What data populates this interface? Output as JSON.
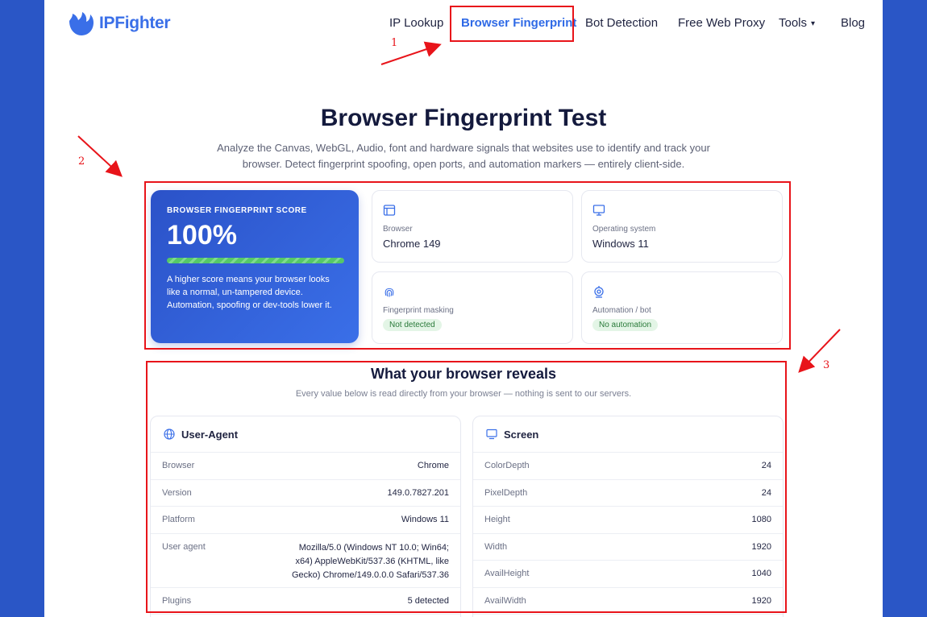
{
  "nav": {
    "brand": "IPFighter",
    "items": [
      "IP Lookup",
      "Browser Fingerprint",
      "Bot Detection",
      "Free Web Proxy",
      "Tools",
      "Blog"
    ],
    "active": "Browser Fingerprint"
  },
  "annotations": [
    "1",
    "2",
    "3"
  ],
  "hero": {
    "title": "Browser Fingerprint Test",
    "subtitle": "Analyze the Canvas, WebGL, Audio, font and hardware signals that websites use to identify and track your browser. Detect fingerprint spoofing, open ports, and automation markers — entirely client-side."
  },
  "score": {
    "label": "BROWSER FINGERPRINT SCORE",
    "value": "100%",
    "progress": 1.0,
    "description": "A higher score means your browser looks like a normal, un-tampered device. Automation, spoofing or dev-tools lower it."
  },
  "cards": {
    "browser": {
      "label": "Browser",
      "value": "Chrome 149",
      "icon": "browser-window-icon"
    },
    "os": {
      "label": "Operating system",
      "value": "Windows 11",
      "icon": "monitor-icon"
    },
    "masking": {
      "label": "Fingerprint masking",
      "value": "Not detected",
      "icon": "fingerprint-icon"
    },
    "automation": {
      "label": "Automation / bot",
      "value": "No automation",
      "icon": "webcam-icon"
    }
  },
  "reveals": {
    "title": "What your browser reveals",
    "subtitle": "Every value below is read directly from your browser — nothing is sent to our servers."
  },
  "user_agent": {
    "title": "User-Agent",
    "rows": [
      {
        "key": "Browser",
        "value": "Chrome"
      },
      {
        "key": "Version",
        "value": "149.0.7827.201"
      },
      {
        "key": "Platform",
        "value": "Windows 11"
      },
      {
        "key": "User agent",
        "value": "Mozilla/5.0 (Windows NT 10.0; Win64; x64) AppleWebKit/537.36 (KHTML, like Gecko) Chrome/149.0.0.0 Safari/537.36"
      },
      {
        "key": "Plugins",
        "value": "5 detected"
      }
    ]
  },
  "screen": {
    "title": "Screen",
    "rows": [
      {
        "key": "ColorDepth",
        "value": "24"
      },
      {
        "key": "PixelDepth",
        "value": "24"
      },
      {
        "key": "Height",
        "value": "1080"
      },
      {
        "key": "Width",
        "value": "1920"
      },
      {
        "key": "AvailHeight",
        "value": "1040"
      },
      {
        "key": "AvailWidth",
        "value": "1920"
      }
    ]
  },
  "colors": {
    "brand": "#3a6fe8",
    "annotation": "#e8141a",
    "success": "#55c868",
    "background": "#2a56c6"
  }
}
